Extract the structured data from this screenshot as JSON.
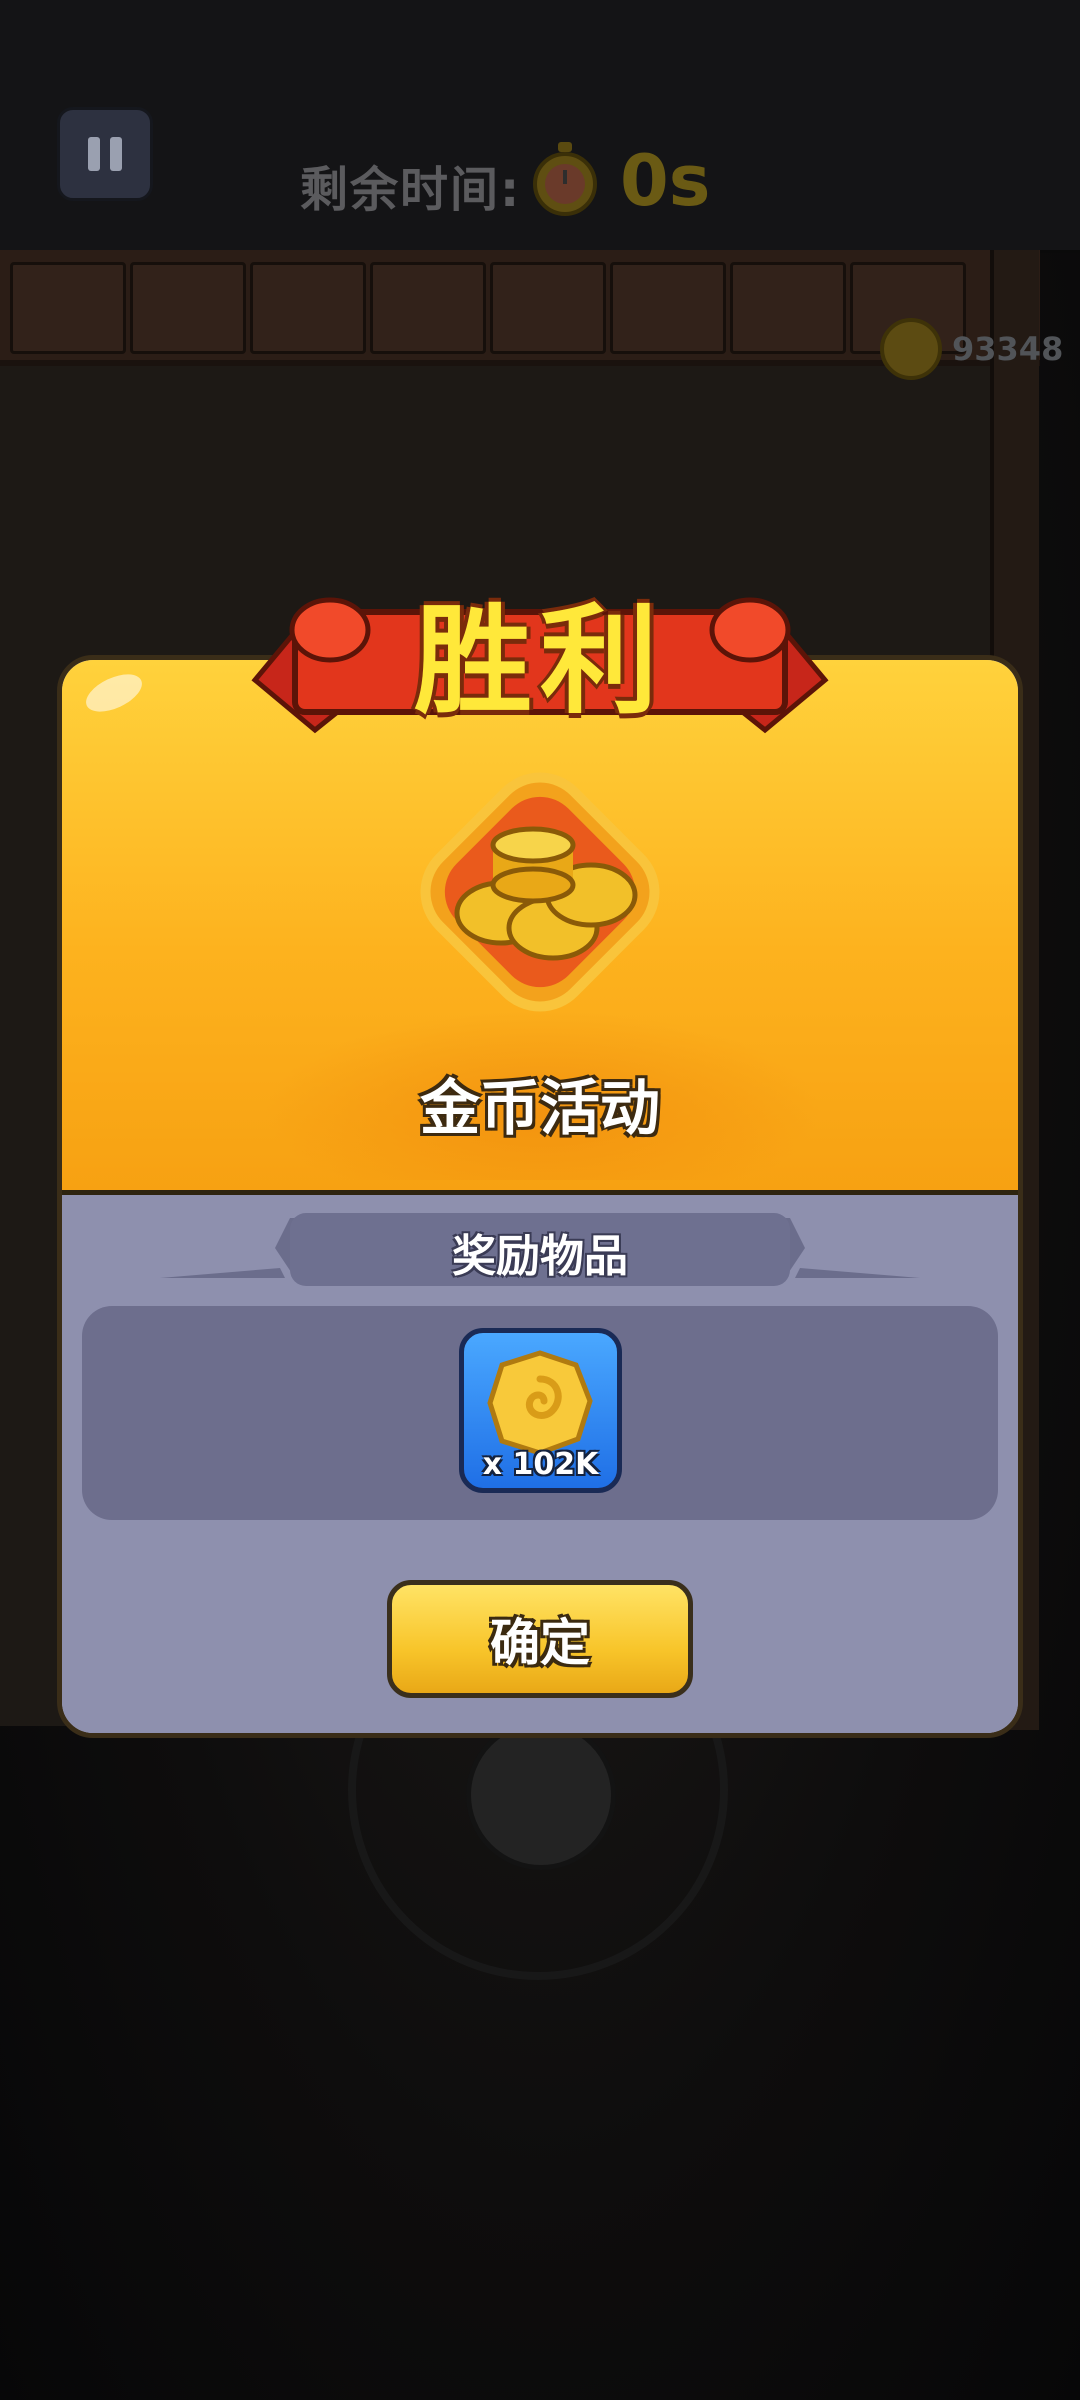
{
  "hud": {
    "timer_label": "剩余时间:",
    "timer_value": "0s",
    "coin_balance": "93348"
  },
  "dialog": {
    "title": "胜利",
    "event_name": "金币活动",
    "reward_header": "奖励物品",
    "rewards": [
      {
        "icon": "gold-coin-icon",
        "quantity": "x 102K"
      }
    ],
    "confirm_label": "确定"
  },
  "colors": {
    "banner_gold": "#fdb21e",
    "ribbon_red": "#e2361c",
    "reward_tile_blue": "#2f86f2",
    "confirm_yellow": "#f8c52a",
    "panel_gray": "#8e90ae"
  }
}
